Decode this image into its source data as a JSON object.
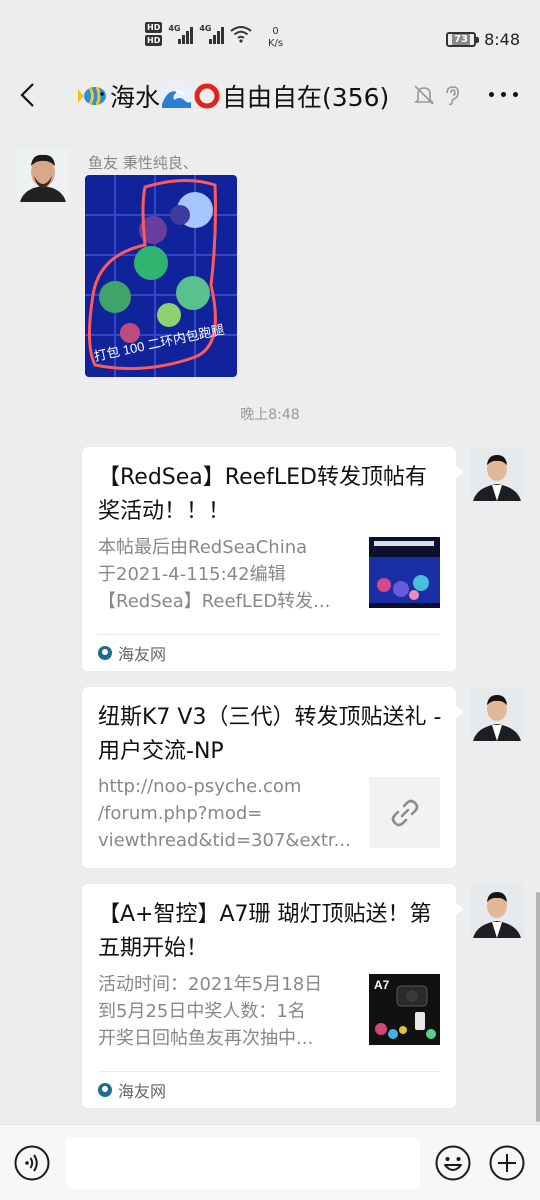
{
  "status_bar": {
    "network_speed_value": "0",
    "network_speed_unit": "K/s",
    "battery_level": "73",
    "time": "8:48",
    "signal_label_1": "4G",
    "signal_label_2": "4G",
    "hd_label": "HD"
  },
  "header": {
    "title_text_1": "海水",
    "title_text_2": "自由自在(356)"
  },
  "chat": {
    "incoming": {
      "sender_name": "鱼友 秉性纯良、",
      "photo_caption": "打包 100 二环内包跑腿"
    },
    "timestamp": "晚上8:48",
    "cards": [
      {
        "title": "【RedSea】ReefLED转发顶帖有奖活动！！！",
        "desc_lines": [
          "本帖最后由RedSeaChina",
          "于2021-4-115:42编辑",
          "【RedSea】ReefLED转发..."
        ],
        "source": "海友网",
        "thumb": "reef-tank-thumbnail"
      },
      {
        "title": "纽斯K7 V3（三代）转发顶贴送礼 - 用户交流-NP",
        "desc_lines": [
          "http://noo-psyche.com",
          "/forum.php?mod=",
          "viewthread&tid=307&extr..."
        ],
        "thumb": "link-icon"
      },
      {
        "title": "【A+智控】A7珊 瑚灯顶贴送！第五期开始！",
        "desc_lines": [
          "活动时间：2021年5月18日",
          "到5月25日中奖人数：1名",
          "开奖日回帖鱼友再次抽中..."
        ],
        "source": "海友网",
        "thumb": "a7-product-thumbnail",
        "thumb_label": "A7"
      }
    ]
  },
  "input_bar": {
    "placeholder": ""
  }
}
